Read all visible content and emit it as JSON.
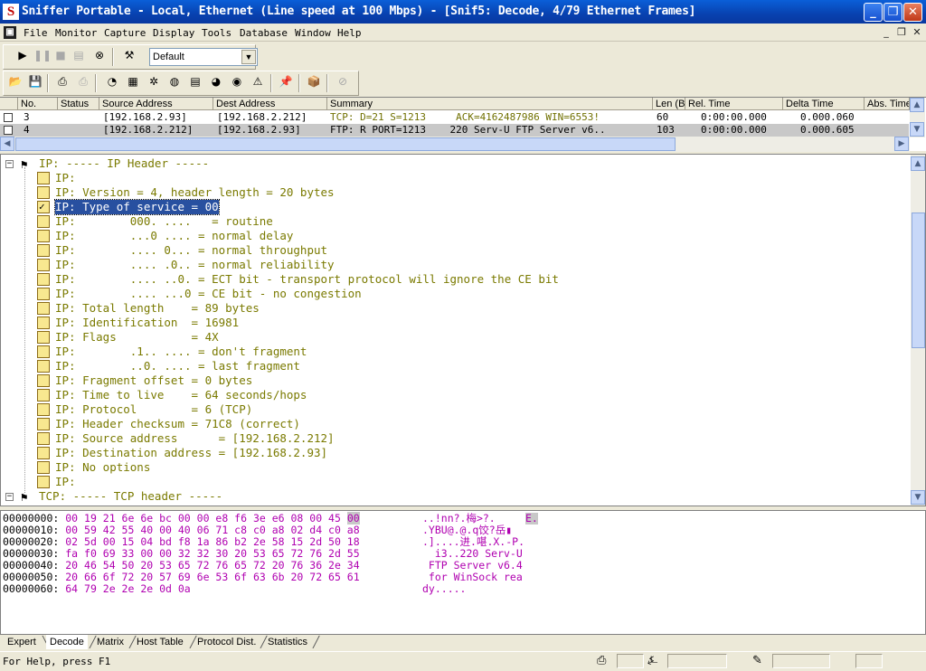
{
  "window": {
    "title": "Sniffer Portable - Local, Ethernet (Line speed at 100 Mbps) - [Snif5: Decode, 4/79 Ethernet Frames]",
    "app_icon": "S"
  },
  "menu": [
    "File",
    "Monitor",
    "Capture",
    "Display",
    "Tools",
    "Database",
    "Window",
    "Help"
  ],
  "toolbar": {
    "profile_select": "Default"
  },
  "packet_list": {
    "columns": [
      "No.",
      "Status",
      "Source Address",
      "Dest Address",
      "Summary",
      "Len (B",
      "Rel. Time",
      "Delta Time",
      "Abs. Time"
    ],
    "rows": [
      {
        "no": "3",
        "status": "",
        "src": "[192.168.2.93]",
        "dst": "[192.168.2.212]",
        "summary": "TCP: D=21 S=1213     ACK=4162487986 WIN=6553!",
        "len": "60",
        "rel": "0:00:00.000",
        "delta": "0.000.060",
        "abs": ""
      },
      {
        "no": "4",
        "status": "",
        "src": "[192.168.2.212]",
        "dst": "[192.168.2.93]",
        "summary": "FTP: R PORT=1213    220 Serv-U FTP Server v6..",
        "len": "103",
        "rel": "0:00:00.000",
        "delta": "0.000.605",
        "abs": ""
      }
    ]
  },
  "decode": {
    "ip_header": "IP: ----- IP Header -----",
    "lines": [
      "IP:",
      "IP: Version = 4, header length = 20 bytes",
      "IP: Type of service = 00",
      "IP:        000. ....   = routine",
      "IP:        ...0 .... = normal delay",
      "IP:        .... 0... = normal throughput",
      "IP:        .... .0.. = normal reliability",
      "IP:        .... ..0. = ECT bit - transport protocol will ignore the CE bit",
      "IP:        .... ...0 = CE bit - no congestion",
      "IP: Total length    = 89 bytes",
      "IP: Identification  = 16981",
      "IP: Flags           = 4X",
      "IP:        .1.. .... = don't fragment",
      "IP:        ..0. .... = last fragment",
      "IP: Fragment offset = 0 bytes",
      "IP: Time to live    = 64 seconds/hops",
      "IP: Protocol        = 6 (TCP)",
      "IP: Header checksum = 71C8 (correct)",
      "IP: Source address      = [192.168.2.212]",
      "IP: Destination address = [192.168.2.93]",
      "IP: No options",
      "IP:"
    ],
    "tcp_header": "TCP: ----- TCP header -----"
  },
  "hex": [
    {
      "off": "00000000:",
      "bytes": "00 19 21 6e 6e bc 00 00 e8 f6 3e e6 08 00 45",
      "sel": "00",
      "ascii": "..!nn?.梅>?.",
      "ascii_sel": "E."
    },
    {
      "off": "00000010:",
      "bytes": "00 59 42 55 40 00 40 06 71 c8 c0 a8 02 d4 c0 a8",
      "sel": "",
      "ascii": ".YBU@.@.q饺?岳▮",
      "ascii_sel": ""
    },
    {
      "off": "00000020:",
      "bytes": "02 5d 00 15 04 bd f8 1a 86 b2 2e 58 15 2d 50 18",
      "sel": "",
      "ascii": ".]....进.啿.X.-P.",
      "ascii_sel": ""
    },
    {
      "off": "00000030:",
      "bytes": "fa f0 69 33 00 00 32 32 30 20 53 65 72 76 2d 55",
      "sel": "",
      "ascii": "  i3..220 Serv-U",
      "ascii_sel": ""
    },
    {
      "off": "00000040:",
      "bytes": "20 46 54 50 20 53 65 72 76 65 72 20 76 36 2e 34",
      "sel": "",
      "ascii": " FTP Server v6.4",
      "ascii_sel": ""
    },
    {
      "off": "00000050:",
      "bytes": "20 66 6f 72 20 57 69 6e 53 6f 63 6b 20 72 65 61",
      "sel": "",
      "ascii": " for WinSock rea",
      "ascii_sel": ""
    },
    {
      "off": "00000060:",
      "bytes": "64 79 2e 2e 2e 0d 0a                              ",
      "sel": "",
      "ascii": "dy.....",
      "ascii_sel": ""
    }
  ],
  "tabs": [
    "Expert",
    "Decode",
    "Matrix",
    "Host Table",
    "Protocol Dist.",
    "Statistics"
  ],
  "status": {
    "help": "For Help, press F1"
  }
}
